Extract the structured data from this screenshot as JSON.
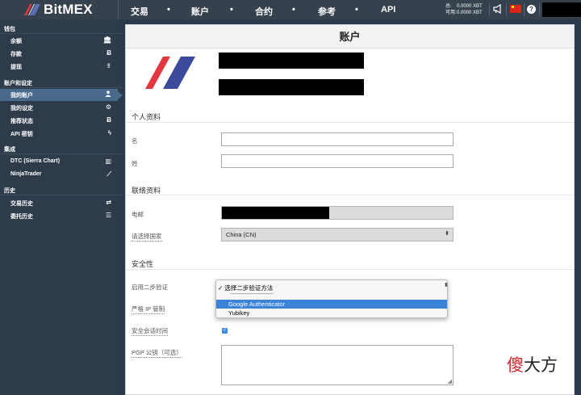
{
  "app": {
    "name": "BitMEX"
  },
  "nav": {
    "items": [
      "交易",
      "账户",
      "合约",
      "参考",
      "API"
    ],
    "dot": "•"
  },
  "balance": {
    "total_label": "总:",
    "total_value": "0.0000 XBT",
    "avail_label": "可用:",
    "avail_value": "0.0000 XBT"
  },
  "header_icons": [
    "megaphone-icon",
    "flag-icon",
    "help-icon"
  ],
  "help_glyph": "?",
  "sidebar": {
    "sections": [
      {
        "title": "钱包",
        "items": [
          {
            "label": "余额",
            "icon": "bank-icon",
            "glyph": "🏛"
          },
          {
            "label": "存款",
            "icon": "bitcoin-icon",
            "glyph": "Ƀ"
          },
          {
            "label": "提现",
            "icon": "upload-icon",
            "glyph": "⇪"
          }
        ]
      },
      {
        "title": "账户和设定",
        "items": [
          {
            "label": "我的账户",
            "icon": "user-icon",
            "glyph": "👤",
            "active": true
          },
          {
            "label": "我的设定",
            "icon": "gear-icon",
            "glyph": "⚙"
          },
          {
            "label": "推荐状态",
            "icon": "bitcoin-icon",
            "glyph": "Ƀ"
          },
          {
            "label": "API 密钥",
            "icon": "bolt-icon",
            "glyph": "ϟ"
          }
        ]
      },
      {
        "title": "集成",
        "items": [
          {
            "label": "DTC (Sierra Chart)",
            "icon": "bar-chart-icon",
            "glyph": "▥"
          },
          {
            "label": "NinjaTrader",
            "icon": "line-chart-icon",
            "glyph": "⟋"
          }
        ]
      },
      {
        "title": "历史",
        "items": [
          {
            "label": "交易历史",
            "icon": "exchange-icon",
            "glyph": "⇄"
          },
          {
            "label": "委托历史",
            "icon": "list-icon",
            "glyph": "☰"
          }
        ]
      }
    ]
  },
  "page": {
    "title": "账户"
  },
  "profile": {
    "section_title": "个人资料",
    "first_name_label": "名",
    "first_name_value": "",
    "last_name_label": "姓",
    "last_name_value": ""
  },
  "contact": {
    "section_title": "联络资料",
    "email_label": "电邮",
    "country_label": "请选择国家",
    "country_value": "China (CN)"
  },
  "security": {
    "section_title": "安全性",
    "two_factor_label": "启用二步验证",
    "two_factor_options": [
      "选择二步验证方法",
      "Google Authenticator",
      "Yubikey"
    ],
    "two_factor_selected": "✓ 选择二步验证方法",
    "two_factor_separator": "------------------------------------",
    "ip_label": "严格 IP 管制",
    "session_label": "安全会话时间",
    "session_checked": true,
    "pgp_label": "PGP 公钥（可选）",
    "pgp_value": ""
  },
  "watermark": {
    "highlight": "傻",
    "rest": "大方"
  },
  "colors": {
    "topbar": "#35414d",
    "sidebar": "#2d3b4a",
    "active": "#4a6a8c",
    "accent_red": "#e1383f",
    "accent_blue": "#3b4a9a"
  }
}
